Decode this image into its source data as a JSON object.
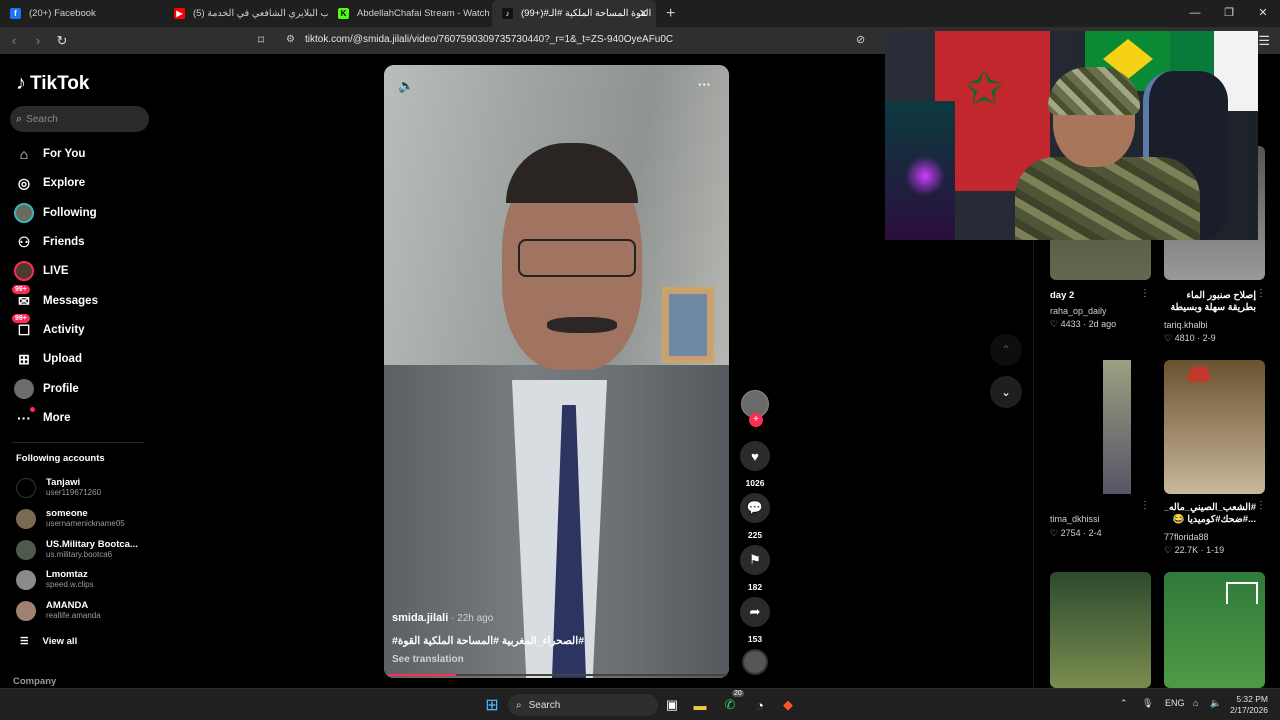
{
  "browser": {
    "tabs": [
      {
        "label": "(20+) Facebook",
        "favicon_color": "#1877f2",
        "favicon_glyph": "f"
      },
      {
        "label": "(5) صاحب البلايري الشافعي في الخدمة",
        "favicon_color": "#ff0000",
        "favicon_glyph": "▶"
      },
      {
        "label": "AbdellahChafai Stream - Watch Live",
        "favicon_color": "#53fc18",
        "favicon_glyph": "K"
      },
      {
        "label": "(99+)#القوة المساحة الملكية #الـ",
        "favicon_color": "#111111",
        "favicon_glyph": "♪"
      }
    ],
    "new_tab": "+",
    "url": "tiktok.com/@smida.jilali/video/7607590309735730440?_r=1&_t=ZS-940OyeAFu0C"
  },
  "sidebar": {
    "brand": "TikTok",
    "search_placeholder": "Search",
    "nav": [
      {
        "label": "For You",
        "icon": "home-icon"
      },
      {
        "label": "Explore",
        "icon": "compass-icon"
      },
      {
        "label": "Following",
        "icon": "avatar"
      },
      {
        "label": "Friends",
        "icon": "friends-icon"
      },
      {
        "label": "LIVE",
        "icon": "live-icon"
      },
      {
        "label": "Messages",
        "icon": "messages-icon",
        "badge": "99+"
      },
      {
        "label": "Activity",
        "icon": "activity-icon",
        "badge": "99+"
      },
      {
        "label": "Upload",
        "icon": "upload-icon"
      },
      {
        "label": "Profile",
        "icon": "profile-icon"
      },
      {
        "label": "More",
        "icon": "more-icon"
      }
    ],
    "following_title": "Following accounts",
    "accounts": [
      {
        "name": "Tanjawi",
        "user": "user119671260"
      },
      {
        "name": "someone",
        "user": "usernamenickname05"
      },
      {
        "name": "US.Military Bootca...",
        "user": "us.military.bootca6"
      },
      {
        "name": "Lmomtaz",
        "user": "speed.w.clips"
      },
      {
        "name": "AMANDA",
        "user": "reallife.amanda"
      }
    ],
    "view_all": "View all",
    "company": "Company"
  },
  "video": {
    "author": "smida.jilali",
    "time_ago": " · 22h ago",
    "description": "#الصحراء_المغربية #المساحة الملكية القوة#",
    "see_translation": "See translation",
    "progress": 0.2,
    "likes": "1026",
    "comments": "225",
    "saves": "182",
    "shares": "153"
  },
  "feed": [
    {
      "title": "day 2",
      "user": "raha_op_daily",
      "likes": "4433",
      "date": "2d ago"
    },
    {
      "title": "إصلاح صنبور الماء بطريقة سهلة وبسيطة #المغرب...",
      "user": "tariq.khalbi",
      "likes": "4810",
      "date": "2-9"
    },
    {
      "title": "",
      "user": "tima_dkhissi",
      "likes": "2754",
      "date": "2-4"
    },
    {
      "title": "#الشعب_الصيني_ماله_حل# ...#ضحك#كوميديا 😂",
      "user": "77florida88",
      "likes": "22.7K",
      "date": "1-19"
    }
  ],
  "taskbar": {
    "search": "Search",
    "whatsapp_badge": "20",
    "lang": "ENG",
    "time": "5:32 PM",
    "date": "2/17/2026"
  }
}
